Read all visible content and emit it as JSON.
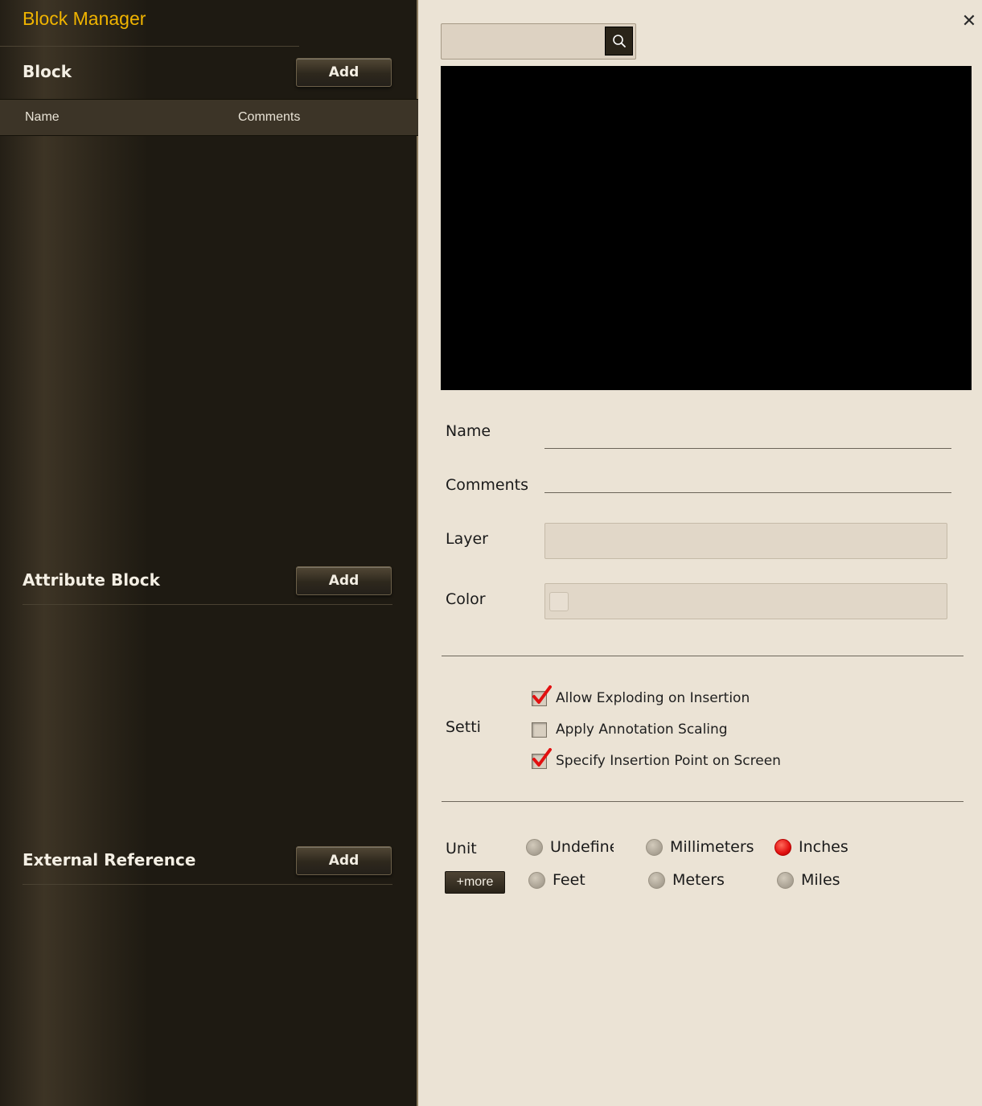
{
  "app": {
    "title": "Block Manager"
  },
  "sections": {
    "block": {
      "title": "Block",
      "add_label": "Add"
    },
    "attribute_block": {
      "title": "Attribute Block",
      "add_label": "Add"
    },
    "external_reference": {
      "title": "External Reference",
      "add_label": "Add"
    }
  },
  "list": {
    "columns": [
      "Name",
      "Comments"
    ]
  },
  "search": {
    "placeholder": "",
    "icon": "search-icon"
  },
  "close": {
    "symbol": "✕",
    "icon": "close-icon"
  },
  "form": {
    "name_label": "Name",
    "name_value": "",
    "comments_label": "Comments",
    "comments_value": "",
    "layer_label": "Layer",
    "layer_value": "",
    "color_label": "Color",
    "color_value": ""
  },
  "settings": {
    "label": "Settings",
    "options": [
      {
        "label": "Allow Exploding on Insertion",
        "checked": true
      },
      {
        "label": "Apply Annotation Scaling",
        "checked": false
      },
      {
        "label": "Specify Insertion Point on Screen",
        "checked": true
      }
    ]
  },
  "unit": {
    "label": "Unit",
    "more_label": "+more",
    "options": [
      {
        "label": "Undefined",
        "selected": false
      },
      {
        "label": "Millimeters",
        "selected": false
      },
      {
        "label": "Inches",
        "selected": true
      },
      {
        "label": "Feet",
        "selected": false
      },
      {
        "label": "Meters",
        "selected": false
      },
      {
        "label": "Miles",
        "selected": false
      }
    ]
  },
  "colors": {
    "accent": "#f0b400",
    "panel_dark": "#1e1a12",
    "panel_light": "#ebe3d5",
    "check_red": "#e21010"
  }
}
